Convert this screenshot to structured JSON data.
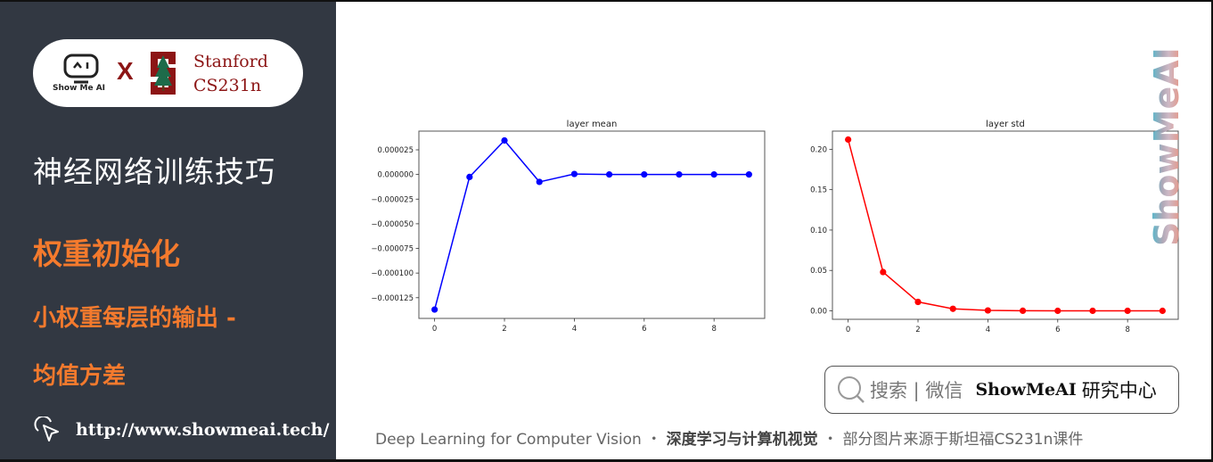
{
  "sidebar": {
    "logo": {
      "showmeai_text": "Show Me AI",
      "cross": "X",
      "partner_line1": "Stanford",
      "partner_line2": "CS231n"
    },
    "course_title": "神经网络训练技巧",
    "section_title": "权重初始化",
    "subtitle_line1": "小权重每层的输出 -",
    "subtitle_line2": "均值方差",
    "link": "http://www.showmeai.tech/"
  },
  "colors": {
    "sidebar_bg": "#323842",
    "accent_orange": "#f47a2d",
    "stanford_red": "#8c1515",
    "mean_series": "#0000ff",
    "std_series": "#ff0000"
  },
  "watermark": "ShowMeAI",
  "search": {
    "placeholder": "搜索 | 微信",
    "brand": "ShowMeAI",
    "brand_suffix": "研究中心"
  },
  "footer": {
    "en": "Deep Learning for Computer Vision",
    "sep": "・",
    "cn_bold": "深度学习与计算机视觉",
    "credit": "部分图片来源于斯坦福CS231n课件"
  },
  "chart_data": [
    {
      "type": "line",
      "title": "layer mean",
      "xlabel": "",
      "ylabel": "",
      "x": [
        0,
        1,
        2,
        3,
        4,
        5,
        6,
        7,
        8,
        9
      ],
      "series": [
        {
          "name": "layer mean",
          "color": "#0000ff",
          "marker": "circle",
          "values": [
            -0.000137,
            -2.5e-06,
            3.45e-05,
            -7.5e-06,
            5e-07,
            0.0,
            0.0,
            0.0,
            0.0,
            0.0
          ]
        }
      ],
      "xticks": [
        "0",
        "2",
        "4",
        "6",
        "8"
      ],
      "xtick_values": [
        0,
        2,
        4,
        6,
        8
      ],
      "yticks": [
        "0.000025",
        "0.000000",
        "−0.000025",
        "−0.000050",
        "−0.000075",
        "−0.000100",
        "−0.000125"
      ],
      "ytick_values": [
        2.5e-05,
        0.0,
        -2.5e-05,
        -5e-05,
        -7.5e-05,
        -0.0001,
        -0.000125
      ],
      "xlim": [
        -0.45,
        9.45
      ],
      "ylim": [
        -0.000146,
        4.4e-05
      ],
      "grid": false,
      "legend": "none"
    },
    {
      "type": "line",
      "title": "layer std",
      "xlabel": "",
      "ylabel": "",
      "x": [
        0,
        1,
        2,
        3,
        4,
        5,
        6,
        7,
        8,
        9
      ],
      "series": [
        {
          "name": "layer std",
          "color": "#ff0000",
          "marker": "circle",
          "values": [
            0.212,
            0.048,
            0.011,
            0.0025,
            0.0005,
            0.0001,
            0.0,
            0.0,
            0.0,
            0.0
          ]
        }
      ],
      "xticks": [
        "0",
        "2",
        "4",
        "6",
        "8"
      ],
      "xtick_values": [
        0,
        2,
        4,
        6,
        8
      ],
      "yticks": [
        "0.20",
        "0.15",
        "0.10",
        "0.05",
        "0.00"
      ],
      "ytick_values": [
        0.2,
        0.15,
        0.1,
        0.05,
        0.0
      ],
      "xlim": [
        -0.45,
        9.45
      ],
      "ylim": [
        -0.0105,
        0.2225
      ],
      "grid": false,
      "legend": "none"
    }
  ]
}
